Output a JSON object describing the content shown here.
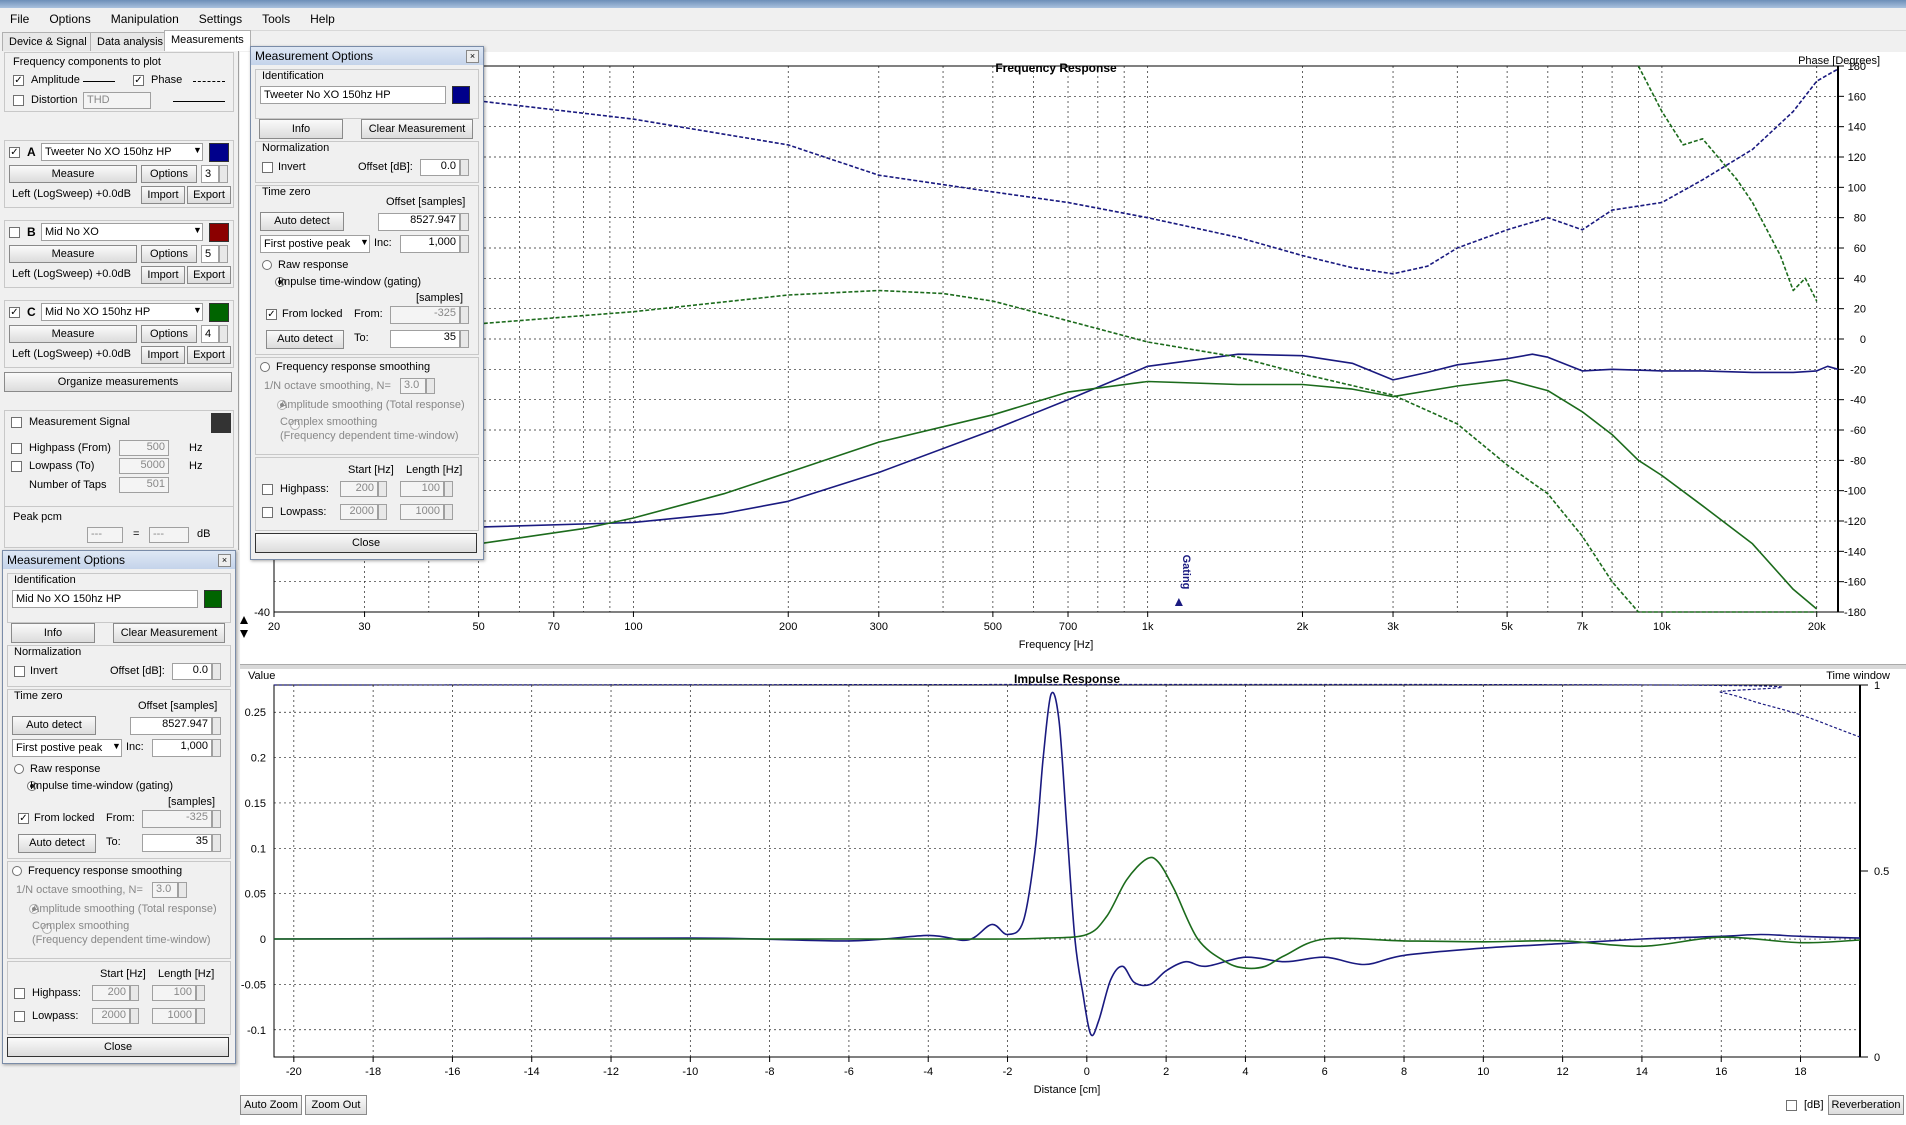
{
  "menu": [
    "File",
    "Options",
    "Manipulation",
    "Settings",
    "Tools",
    "Help"
  ],
  "tabs": [
    "Device & Signal",
    "Data analysis",
    "Measurements"
  ],
  "freq_components": {
    "title": "Frequency components to plot",
    "amplitude": "Amplitude",
    "phase": "Phase",
    "distortion": "Distortion",
    "thd": "THD"
  },
  "measurements": [
    {
      "letter": "A",
      "name": "Tweeter No XO 150hz HP",
      "checked": true,
      "color": "#00008b",
      "count": "3",
      "sweep": "Left (LogSweep) +0.0dB"
    },
    {
      "letter": "B",
      "name": "Mid No XO",
      "checked": false,
      "color": "#8b0000",
      "count": "5",
      "sweep": "Left (LogSweep) +0.0dB"
    },
    {
      "letter": "C",
      "name": "Mid No XO 150hz HP",
      "checked": true,
      "color": "#006400",
      "count": "4",
      "sweep": "Left (LogSweep) +0.0dB"
    }
  ],
  "buttons": {
    "measure": "Measure",
    "options": "Options",
    "import": "Import",
    "export": "Export",
    "organize": "Organize measurements"
  },
  "signal": {
    "measurement_signal": "Measurement Signal",
    "highpass": "Highpass (From)",
    "highpass_val": "500",
    "lowpass": "Lowpass (To)",
    "lowpass_val": "5000",
    "taps": "Number of Taps",
    "taps_val": "501",
    "hz": "Hz",
    "peak": "Peak pcm",
    "dash1": "---",
    "eq": "=",
    "dash2": "---",
    "db": "dB"
  },
  "options_dialogs": [
    {
      "title": "Measurement Options",
      "name": "Tweeter No XO 150hz HP",
      "color": "#00008b"
    },
    {
      "title": "Measurement Options",
      "name": "Mid No XO 150hz HP",
      "color": "#006400"
    }
  ],
  "dlg": {
    "identification": "Identification",
    "info": "Info",
    "clear": "Clear Measurement",
    "normalization": "Normalization",
    "invert": "Invert",
    "offset_db": "Offset [dB]:",
    "offset_db_val": "0.0",
    "time_zero": "Time zero",
    "offset_samples": "Offset [samples]",
    "auto_detect": "Auto detect",
    "offset_val": "8527.947",
    "peak_mode": "First postive peak",
    "inc": "Inc:",
    "inc_val": "1,000",
    "raw": "Raw response",
    "gating": "Impulse time-window (gating)",
    "samples": "[samples]",
    "from_locked": "From locked",
    "from": "From:",
    "from_val": "-325",
    "to": "To:",
    "to_val": "35",
    "smoothing": "Frequency response smoothing",
    "octave": "1/N octave smoothing, N=",
    "octave_val": "3.0",
    "amp_smooth": "Amplitude smoothing (Total response)",
    "complex_smooth": "Complex smoothing",
    "complex_sub": "(Frequency dependent time-window)",
    "start_hz": "Start [Hz]",
    "length_hz": "Length [Hz]",
    "highpass": "Highpass:",
    "hp_start": "200",
    "hp_len": "100",
    "lowpass": "Lowpass:",
    "lp_start": "2000",
    "lp_len": "1000",
    "close": "Close"
  },
  "chart_data": [
    {
      "type": "line",
      "title": "Frequency Response",
      "xlabel": "Frequency [Hz]",
      "y2label": "Phase [Degrees]",
      "xscale": "log",
      "xlim": [
        20,
        22000
      ],
      "ylim": [
        -40,
        5
      ],
      "y2lim": [
        -180,
        180
      ],
      "x_ticks": [
        "20",
        "30",
        "50",
        "70",
        "100",
        "200",
        "300",
        "500",
        "700",
        "1k",
        "2k",
        "3k",
        "5k",
        "7k",
        "10k",
        "20k"
      ],
      "x_tick_values": [
        20,
        30,
        50,
        70,
        100,
        200,
        300,
        500,
        700,
        1000,
        2000,
        3000,
        5000,
        7000,
        10000,
        20000
      ],
      "y_ticks": [
        "-40"
      ],
      "y2_ticks": [
        "180",
        "160",
        "140",
        "120",
        "100",
        "80",
        "60",
        "40",
        "20",
        "0",
        "-20",
        "-40",
        "-60",
        "-80",
        "-100",
        "-120",
        "-140",
        "-160",
        "-180"
      ],
      "marker": "Gating",
      "marker_x": 1150,
      "grid": true,
      "series": [
        {
          "name": "Tweeter No XO 150hz HP",
          "kind": "amplitude",
          "color": "#1a1a80",
          "axis": "y2",
          "x": [
            20,
            50,
            100,
            150,
            200,
            300,
            500,
            700,
            1000,
            1500,
            2000,
            2500,
            3000,
            3500,
            4000,
            5000,
            5600,
            6000,
            7000,
            8000,
            10000,
            12000,
            15000,
            18000,
            20000,
            21000,
            22000
          ],
          "y": [
            -127,
            -124,
            -121,
            -115,
            -107,
            -88,
            -60,
            -40,
            -18,
            -10,
            -11,
            -16,
            -27,
            -22,
            -17,
            -13,
            -10,
            -12,
            -21,
            -20,
            -21,
            -21,
            -22,
            -22,
            -21,
            -18,
            -20
          ]
        },
        {
          "name": "Mid No XO 150hz HP",
          "kind": "amplitude",
          "color": "#1c6b1c",
          "axis": "y2",
          "x": [
            20,
            50,
            80,
            100,
            150,
            200,
            300,
            500,
            700,
            1000,
            1500,
            2000,
            2500,
            3000,
            4000,
            5000,
            6000,
            7000,
            8000,
            9000,
            10000,
            12000,
            15000,
            18000,
            20000
          ],
          "y": [
            -145,
            -135,
            -125,
            -118,
            -102,
            -88,
            -68,
            -50,
            -35,
            -28,
            -30,
            -30,
            -33,
            -38,
            -31,
            -27,
            -34,
            -48,
            -63,
            -80,
            -90,
            -110,
            -135,
            -165,
            -178
          ]
        },
        {
          "name": "Tweeter No XO 150hz HP",
          "kind": "phase",
          "color": "#1a1a80",
          "axis": "y2",
          "x": [
            20,
            50,
            100,
            200,
            300,
            500,
            700,
            1000,
            1500,
            2000,
            2500,
            3000,
            3500,
            4000,
            5000,
            6000,
            7000,
            8000,
            10000,
            12000,
            15000,
            18000,
            20000,
            22000
          ],
          "y": [
            164,
            157,
            145,
            128,
            108,
            97,
            90,
            80,
            67,
            55,
            47,
            43,
            48,
            60,
            72,
            80,
            72,
            85,
            90,
            105,
            125,
            150,
            170,
            178
          ]
        },
        {
          "name": "Mid No XO 150hz HP",
          "kind": "phase",
          "color": "#1c6b1c",
          "axis": "y2",
          "x": [
            20,
            50,
            100,
            200,
            300,
            400,
            500,
            700,
            1000,
            1500,
            2000,
            3000,
            4000,
            5000,
            6000,
            7000,
            8000,
            9000,
            10000,
            12000,
            15000,
            18000,
            20000
          ],
          "y": [
            4,
            10,
            18,
            29,
            32,
            30,
            25,
            12,
            -2,
            -12,
            -23,
            -37,
            -56,
            -83,
            -102,
            -130,
            -160,
            -180,
            -190,
            -200,
            -210,
            -220,
            -225
          ]
        },
        {
          "name": "Mid No XO 150hz HP",
          "kind": "phase-hf",
          "color": "#1c6b1c",
          "axis": "y2",
          "x": [
            9000,
            10000,
            11000,
            12000,
            13000,
            14000,
            15000,
            16000,
            17000,
            18000,
            19000,
            20000
          ],
          "y": [
            180,
            150,
            128,
            132,
            118,
            105,
            90,
            72,
            55,
            32,
            40,
            25
          ]
        }
      ]
    },
    {
      "type": "line",
      "title": "Impulse Response",
      "xlabel": "Distance [cm]",
      "ylabel": "Value",
      "y2label": "Time window",
      "xlim": [
        -20.5,
        19.5
      ],
      "ylim": [
        -0.13,
        0.28
      ],
      "y2lim": [
        0,
        1
      ],
      "x_ticks": [
        "-20",
        "-18",
        "-16",
        "-14",
        "-12",
        "-10",
        "-8",
        "-6",
        "-4",
        "-2",
        "0",
        "2",
        "4",
        "6",
        "8",
        "10",
        "12",
        "14",
        "16",
        "18"
      ],
      "x_tick_values": [
        -20,
        -18,
        -16,
        -14,
        -12,
        -10,
        -8,
        -6,
        -4,
        -2,
        0,
        2,
        4,
        6,
        8,
        10,
        12,
        14,
        16,
        18
      ],
      "y_ticks": [
        "0.25",
        "0.2",
        "0.15",
        "0.1",
        "0.05",
        "0",
        "-0.05",
        "-0.1"
      ],
      "y_tick_values": [
        0.25,
        0.2,
        0.15,
        0.1,
        0.05,
        0,
        -0.05,
        -0.1
      ],
      "y2_ticks": [
        "1",
        "0.5",
        "0"
      ],
      "y2_tick_values": [
        1,
        0.5,
        0
      ],
      "grid": true,
      "series": [
        {
          "name": "Tweeter No XO 150hz HP",
          "color": "#1a1a80",
          "x": [
            -20.5,
            -10,
            -6,
            -4,
            -3,
            -2.4,
            -2,
            -1.6,
            -1.3,
            -1.1,
            -0.9,
            -0.7,
            -0.5,
            -0.3,
            -0.1,
            0.1,
            0.3,
            0.6,
            0.9,
            1.2,
            1.6,
            2,
            2.5,
            3,
            4,
            5,
            6,
            7,
            8,
            10,
            12,
            14,
            16,
            17,
            18,
            19.5
          ],
          "y": [
            0,
            0.001,
            -0.002,
            0.004,
            -0.001,
            0.016,
            0.005,
            0.02,
            0.1,
            0.2,
            0.27,
            0.24,
            0.12,
            0,
            -0.06,
            -0.105,
            -0.09,
            -0.045,
            -0.03,
            -0.048,
            -0.05,
            -0.035,
            -0.025,
            -0.03,
            -0.02,
            -0.025,
            -0.02,
            -0.028,
            -0.018,
            -0.01,
            -0.005,
            0,
            0.003,
            0.005,
            0.003,
            0.001
          ]
        },
        {
          "name": "Mid No XO 150hz HP",
          "color": "#1c6b1c",
          "x": [
            -20.5,
            -10,
            -4,
            -2,
            -1,
            0,
            0.5,
            1,
            1.5,
            1.8,
            2.2,
            2.8,
            3.5,
            4,
            4.5,
            5,
            6,
            8,
            10,
            12,
            14,
            16,
            18,
            19.5
          ],
          "y": [
            0,
            0,
            0,
            0,
            0.001,
            0.005,
            0.025,
            0.065,
            0.088,
            0.085,
            0.055,
            0.0,
            -0.025,
            -0.032,
            -0.03,
            -0.018,
            0,
            -0.002,
            -0.003,
            -0.002,
            -0.008,
            0.002,
            -0.004,
            -0.001
          ]
        },
        {
          "name": "Time window",
          "color": "#1a1a80",
          "dashed": true,
          "axis": "y2",
          "x": [
            -20.5,
            14.5,
            16,
            17,
            18,
            19,
            19.5
          ],
          "y": [
            1,
            1,
            0.98,
            0.95,
            0.92,
            0.88,
            0.86
          ]
        }
      ]
    }
  ],
  "bottom": {
    "auto_zoom": "Auto Zoom",
    "zoom_out": "Zoom Out",
    "db": "[dB]",
    "reverberation": "Reverberation"
  }
}
